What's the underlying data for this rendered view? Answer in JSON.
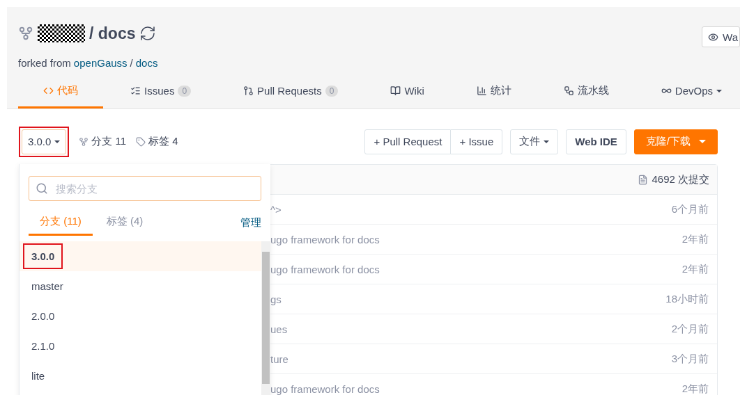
{
  "repo": {
    "title": "/ docs",
    "forked_prefix": "forked from",
    "fork_owner": "openGauss",
    "fork_sep": "/",
    "fork_repo": "docs",
    "watch": "Wa"
  },
  "nav_tabs": [
    {
      "label": "代码",
      "selected": true
    },
    {
      "label": "Issues",
      "count": "0",
      "selected": false
    },
    {
      "label": "Pull Requests",
      "count": "0",
      "selected": false
    },
    {
      "label": "Wiki",
      "selected": false
    },
    {
      "label": "统计",
      "selected": false
    },
    {
      "label": "流水线",
      "selected": false
    },
    {
      "label": "DevOps",
      "selected": false,
      "dropdown": true
    }
  ],
  "toolbar": {
    "branch_button": {
      "label": "3.0.0",
      "highlighted": true
    },
    "branches": "分支 11",
    "tags": "标签 4",
    "pr_button": "+ Pull Request",
    "issue_button": "+ Issue",
    "file_button": "文件",
    "ide_button": "Web IDE",
    "clone_button": "克隆/下载"
  },
  "commits": {
    "count": "4692 次提交"
  },
  "rows": [
    {
      "message": "^>",
      "time": "6个月前"
    },
    {
      "message": "ugo framework for docs",
      "time": "2年前"
    },
    {
      "message": "ugo framework for docs",
      "time": "2年前"
    },
    {
      "message": "gs",
      "time": "18小时前"
    },
    {
      "message": "ues",
      "time": "2个月前"
    },
    {
      "message": "ture",
      "time": "3个月前"
    },
    {
      "message": "ugo framework for docs",
      "time": "2年前"
    }
  ],
  "branch_menu": {
    "search": {
      "placeholder": "搜索分支"
    },
    "tabs": [
      {
        "label": "分支 (11)",
        "selected": true
      },
      {
        "label": "标签 (4)",
        "selected": false
      }
    ],
    "manage": "管理",
    "branches": [
      {
        "name": "3.0.0",
        "selected": true,
        "highlighted": true
      },
      {
        "name": "master",
        "selected": false,
        "highlighted": false
      },
      {
        "name": "2.0.0",
        "selected": false,
        "highlighted": false
      },
      {
        "name": "2.1.0",
        "selected": false,
        "highlighted": false
      },
      {
        "name": "lite",
        "selected": false,
        "highlighted": false
      }
    ]
  }
}
